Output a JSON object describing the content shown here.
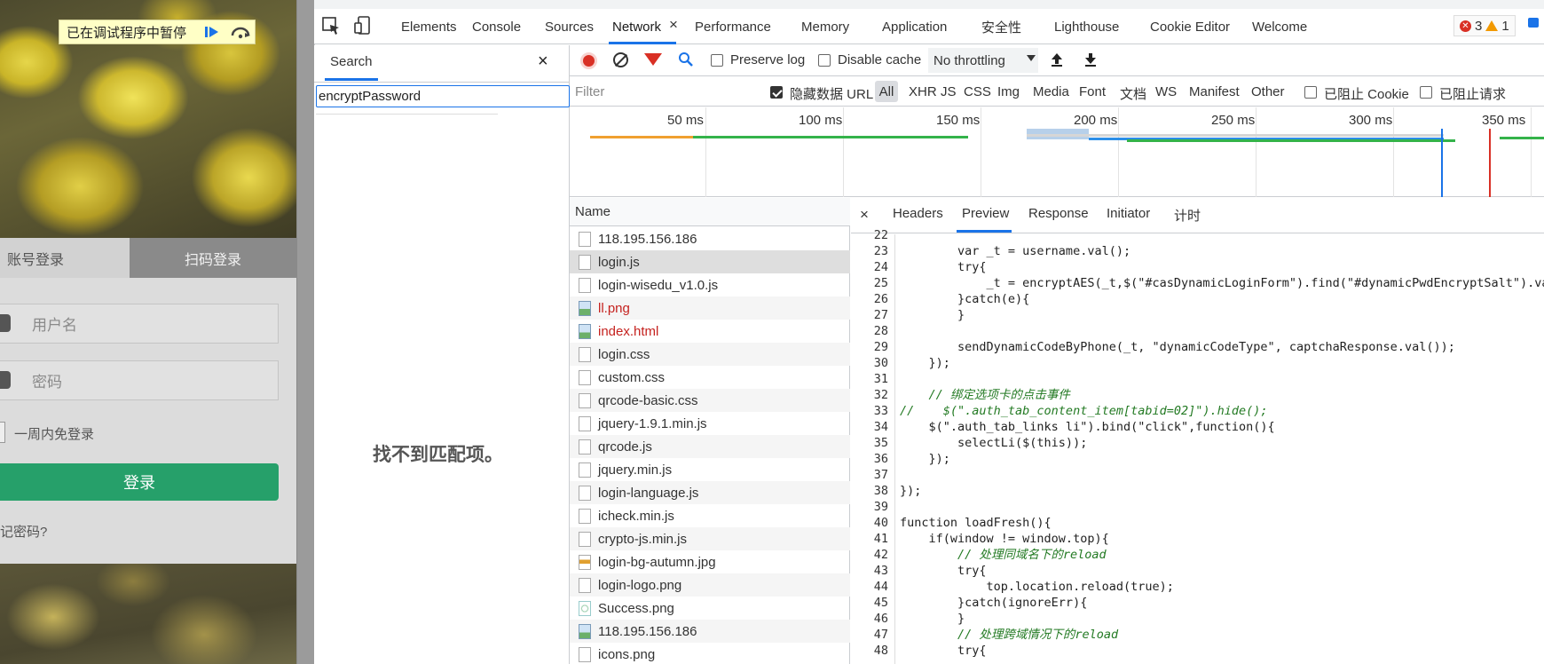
{
  "page": {
    "debug_banner": "已在调试程序中暂停",
    "tab_account": "账号登录",
    "tab_qr": "扫码登录",
    "username_placeholder": "用户名",
    "password_placeholder": "密码",
    "remember_label": "一周内免登录",
    "login_button": "登录",
    "forgot_text": "记密码?"
  },
  "devtools": {
    "tabs": [
      "Elements",
      "Console",
      "Sources",
      "Network",
      "Performance",
      "Memory",
      "Application",
      "安全性",
      "Lighthouse",
      "Cookie Editor",
      "Welcome"
    ],
    "tab_close": "×",
    "errors": "3",
    "warnings": "1"
  },
  "search": {
    "title": "Search",
    "close": "×",
    "query": "encryptPassword",
    "no_match": "找不到匹配项。"
  },
  "network": {
    "preserve_log": "Preserve log",
    "disable_cache": "Disable cache",
    "throttling": "No throttling",
    "filter_placeholder": "Filter",
    "hide_data_urls": "隐藏数据 URL",
    "types": [
      "All",
      "XHR",
      "JS",
      "CSS",
      "Img",
      "Media",
      "Font",
      "文档",
      "WS",
      "Manifest",
      "Other"
    ],
    "blocked_cookies": "已阻止 Cookie",
    "blocked_requests": "已阻止请求",
    "timeline_labels": [
      "50 ms",
      "100 ms",
      "150 ms",
      "200 ms",
      "250 ms",
      "300 ms",
      "350 ms"
    ],
    "name_header": "Name",
    "requests": [
      {
        "name": "118.195.156.186",
        "icon": "doc",
        "err": false
      },
      {
        "name": "login.js",
        "icon": "doc",
        "err": false
      },
      {
        "name": "login-wisedu_v1.0.js",
        "icon": "doc",
        "err": false
      },
      {
        "name": "ll.png",
        "icon": "img",
        "err": true
      },
      {
        "name": "index.html",
        "icon": "img",
        "err": true
      },
      {
        "name": "login.css",
        "icon": "doc",
        "err": false
      },
      {
        "name": "custom.css",
        "icon": "doc",
        "err": false
      },
      {
        "name": "qrcode-basic.css",
        "icon": "doc",
        "err": false
      },
      {
        "name": "jquery-1.9.1.min.js",
        "icon": "doc",
        "err": false
      },
      {
        "name": "qrcode.js",
        "icon": "doc",
        "err": false
      },
      {
        "name": "jquery.min.js",
        "icon": "doc",
        "err": false
      },
      {
        "name": "login-language.js",
        "icon": "doc",
        "err": false
      },
      {
        "name": "icheck.min.js",
        "icon": "doc",
        "err": false
      },
      {
        "name": "crypto-js.min.js",
        "icon": "doc",
        "err": false
      },
      {
        "name": "login-bg-autumn.jpg",
        "icon": "jpg",
        "err": false
      },
      {
        "name": "login-logo.png",
        "icon": "doc",
        "err": false
      },
      {
        "name": "Success.png",
        "icon": "png2",
        "err": false
      },
      {
        "name": "118.195.156.186",
        "icon": "img",
        "err": false
      },
      {
        "name": "icons.png",
        "icon": "doc",
        "err": false
      }
    ]
  },
  "detail": {
    "close": "×",
    "tabs": [
      "Headers",
      "Preview",
      "Response",
      "Initiator",
      "计时"
    ],
    "line_numbers": [
      "22",
      "23",
      "24",
      "25",
      "26",
      "27",
      "28",
      "29",
      "30",
      "31",
      "32",
      "33",
      "34",
      "35",
      "36",
      "37",
      "38",
      "39",
      "40",
      "41",
      "42",
      "43",
      "44",
      "45",
      "46",
      "47",
      "48"
    ],
    "code_lines": [
      "",
      "        var _t = username.val();",
      "        try{",
      "            _t = encryptAES(_t,$(\"#casDynamicLoginForm\").find(\"#dynamicPwdEncryptSalt\").val());",
      "        }catch(e){",
      "        }",
      "",
      "        sendDynamicCodeByPhone(_t, \"dynamicCodeType\", captchaResponse.val());",
      "    });",
      "",
      "    // 绑定选项卡的点击事件",
      "//    $(\".auth_tab_content_item[tabid=02]\").hide();",
      "    $(\".auth_tab_links li\").bind(\"click\",function(){",
      "        selectLi($(this));",
      "    });",
      "",
      "});",
      "",
      "function loadFresh(){",
      "    if(window != window.top){",
      "        // 处理同域名下的reload",
      "        try{",
      "            top.location.reload(true);",
      "        }catch(ignoreErr){",
      "        }",
      "        // 处理跨域情况下的reload",
      "        try{"
    ]
  }
}
